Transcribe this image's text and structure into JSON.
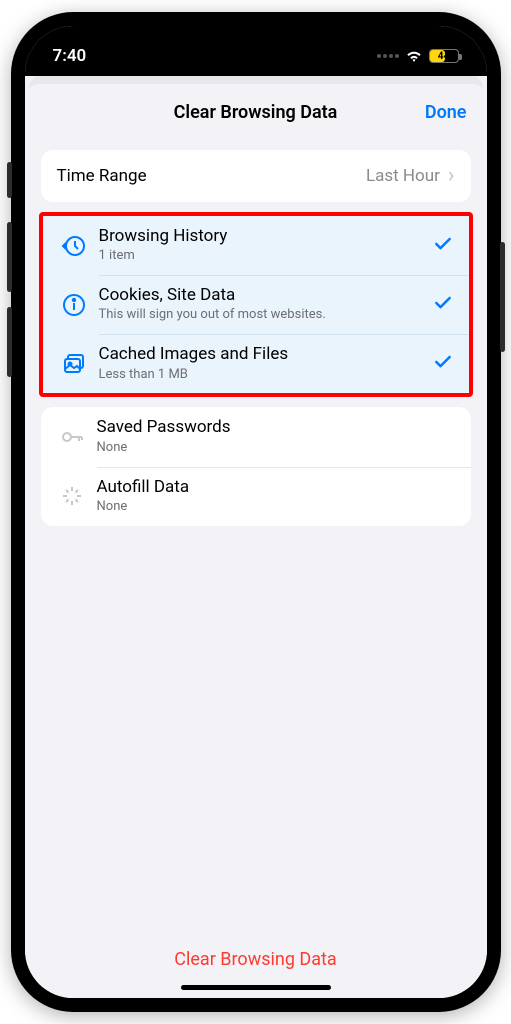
{
  "status": {
    "time": "7:40",
    "battery": "44"
  },
  "nav": {
    "title": "Clear Browsing Data",
    "done": "Done"
  },
  "timeRange": {
    "label": "Time Range",
    "value": "Last Hour"
  },
  "items": {
    "history": {
      "title": "Browsing History",
      "sub": "1 item"
    },
    "cookies": {
      "title": "Cookies, Site Data",
      "sub": "This will sign you out of most websites."
    },
    "cache": {
      "title": "Cached Images and Files",
      "sub": "Less than 1 MB"
    },
    "passwords": {
      "title": "Saved Passwords",
      "sub": "None"
    },
    "autofill": {
      "title": "Autofill Data",
      "sub": "None"
    }
  },
  "clearButton": "Clear Browsing Data",
  "colors": {
    "accent": "#007aff",
    "destructive": "#ff3b30",
    "highlightBorder": "#ff0000"
  }
}
